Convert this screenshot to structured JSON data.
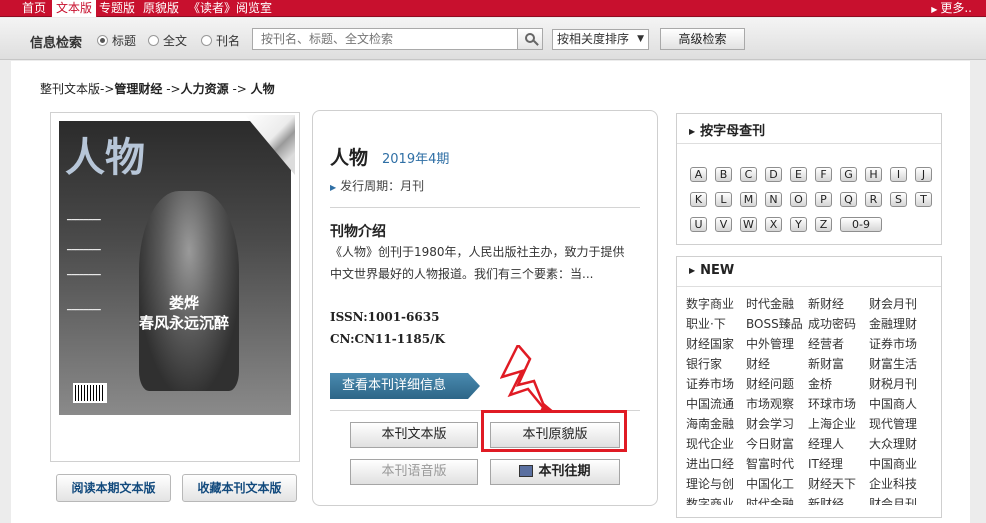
{
  "topnav": {
    "items": [
      "首页",
      "文本版",
      "专题版",
      "原貌版",
      "《读者》阅览室"
    ],
    "active": "文本版",
    "more": "更多.."
  },
  "search": {
    "title": "信息检索",
    "radios": [
      "标题",
      "全文",
      "刊名"
    ],
    "selected": "标题",
    "placeholder": "按刊名、标题、全文检索",
    "sort": "按相关度排序",
    "advanced": "高级检索"
  },
  "breadcrumb": {
    "part1": "整刊文本版->",
    "part2": "管理财经",
    "part3": " ->",
    "part4": "人力资源",
    "part5": " -> ",
    "part6": "人物"
  },
  "cover": {
    "logo": "人物",
    "headline_line1": "娄烨",
    "headline_line2": "春风永远沉醉",
    "read_button": "阅读本期文本版",
    "collect_button": "收藏本刊文本版"
  },
  "magazine": {
    "title": "人物",
    "issue": "2019年4期",
    "cycle_label": "发行周期：月刊",
    "intro_heading": "刊物介绍",
    "intro_text": "《人物》创刊于1980年，人民出版社主办，致力于提供中文世界最好的人物报道。我们有三个要素：当...",
    "issn": "ISSN:1001-6635",
    "cn": "CN:CN11-1185/K",
    "detail_button": "查看本刊详细信息",
    "buttons": {
      "text_version": "本刊文本版",
      "original_version": "本刊原貌版",
      "audio_version": "本刊语音版",
      "past_issues": "本刊往期"
    }
  },
  "letters": {
    "heading": "按字母查刊",
    "row1": [
      "A",
      "B",
      "C",
      "D",
      "E",
      "F",
      "G",
      "H",
      "I",
      "J"
    ],
    "row2": [
      "K",
      "L",
      "M",
      "N",
      "O",
      "P",
      "Q",
      "R",
      "S",
      "T"
    ],
    "row3": [
      "U",
      "V",
      "W",
      "X",
      "Y",
      "Z",
      "0-9"
    ]
  },
  "new_panel": {
    "heading": "NEW",
    "rows": [
      [
        "数字商业",
        "时代金融",
        "新财经",
        "财会月刊"
      ],
      [
        "职业·下",
        "BOSS臻品",
        "成功密码",
        "金融理财"
      ],
      [
        "财经国家",
        "中外管理",
        "经营者",
        "证券市场"
      ],
      [
        "银行家",
        "财经",
        "新财富",
        "财富生活"
      ],
      [
        "证券市场",
        "财经问题",
        "金桥",
        "财税月刊"
      ],
      [
        "中国流通",
        "市场观察",
        "环球市场",
        "中国商人"
      ],
      [
        "海南金融",
        "财会学习",
        "上海企业",
        "现代管理"
      ],
      [
        "现代企业",
        "今日财富",
        "经理人",
        "大众理财"
      ],
      [
        "进出口经",
        "智富时代",
        "IT经理",
        "中国商业"
      ],
      [
        "理论与创",
        "中国化工",
        "财经天下",
        "企业科技"
      ],
      [
        "数字商业",
        "时代金融",
        "新财经",
        "财会月刊"
      ]
    ]
  }
}
